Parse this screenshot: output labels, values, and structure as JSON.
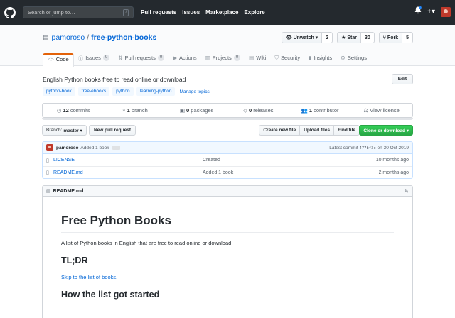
{
  "header": {
    "search_placeholder": "Search or jump to…",
    "search_key": "/",
    "nav": [
      "Pull requests",
      "Issues",
      "Marketplace",
      "Explore"
    ],
    "icons": [
      "github-logo-icon",
      "bell-icon",
      "plus-icon",
      "avatar"
    ]
  },
  "repo": {
    "owner": "pamoroso",
    "separator": "/",
    "name": "free-python-books",
    "watch_label": "Unwatch ▾",
    "watch_count": "2",
    "star_label": "Star",
    "star_count": "30",
    "fork_label": "Fork",
    "fork_count": "5"
  },
  "tabs": [
    {
      "label": "Code",
      "count": "",
      "icon": "code-icon",
      "active": true
    },
    {
      "label": "Issues",
      "count": "0",
      "icon": "issue-icon"
    },
    {
      "label": "Pull requests",
      "count": "0",
      "icon": "pr-icon"
    },
    {
      "label": "Actions",
      "count": "",
      "icon": "play-icon"
    },
    {
      "label": "Projects",
      "count": "0",
      "icon": "project-icon"
    },
    {
      "label": "Wiki",
      "count": "",
      "icon": "book-icon"
    },
    {
      "label": "Security",
      "count": "",
      "icon": "shield-icon"
    },
    {
      "label": "Insights",
      "count": "",
      "icon": "graph-icon"
    },
    {
      "label": "Settings",
      "count": "",
      "icon": "gear-icon"
    }
  ],
  "about": {
    "description": "English Python books free to read online or download",
    "edit_label": "Edit",
    "topics": [
      "python-book",
      "free-ebooks",
      "python",
      "learning-python"
    ],
    "manage_topics": "Manage topics"
  },
  "summary": {
    "commits_count": "12",
    "commits_label": " commits",
    "branch_count": "1",
    "branch_label": " branch",
    "packages_count": "0",
    "packages_label": " packages",
    "releases_count": "0",
    "releases_label": " releases",
    "contributor_count": "1",
    "contributor_label": " contributor",
    "license": "View license"
  },
  "filenav": {
    "branch_prefix": "Branch:",
    "branch_name": "master ▾",
    "new_pr": "New pull request",
    "create_file": "Create new file",
    "upload_files": "Upload files",
    "find_file": "Find file",
    "clone": "Clone or download ▾"
  },
  "latest_commit": {
    "author": "pamoroso",
    "message": "Added 1 book",
    "ellipsis": "…",
    "prefix": "Latest commit ",
    "sha": "477bf3c",
    "date": " on 30 Oct 2019"
  },
  "files": [
    {
      "name": "LICENSE",
      "message": "Created",
      "age": "10 months ago"
    },
    {
      "name": "README.md",
      "message": "Added 1 book",
      "age": "2 months ago"
    }
  ],
  "readme": {
    "filename": "README.md",
    "h1": "Free Python Books",
    "intro": "A list of Python books in English that are free to read online or download.",
    "h2_tldr": "TL;DR",
    "skip_link": "Skip to the list of books.",
    "h2_history": "How the list got started"
  }
}
